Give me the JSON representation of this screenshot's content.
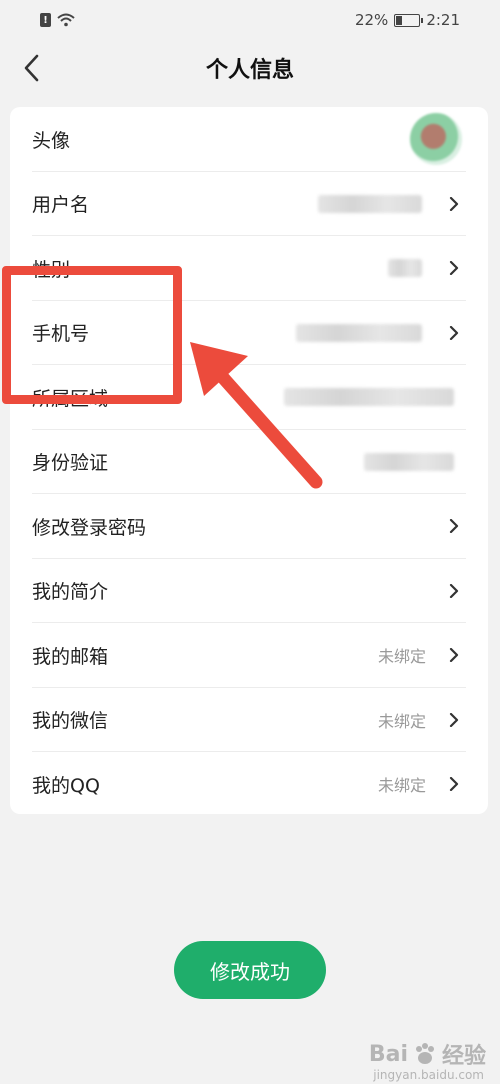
{
  "status_bar": {
    "sim_label": "!",
    "battery_percent": "22%",
    "time": "2:21"
  },
  "header": {
    "title": "个人信息"
  },
  "rows": [
    {
      "label": "头像",
      "value": ""
    },
    {
      "label": "用户名",
      "value": ""
    },
    {
      "label": "性别",
      "value": ""
    },
    {
      "label": "手机号",
      "value": ""
    },
    {
      "label": "所属区域",
      "value": ""
    },
    {
      "label": "身份验证",
      "value": ""
    },
    {
      "label": "修改登录密码",
      "value": ""
    },
    {
      "label": "我的简介",
      "value": ""
    },
    {
      "label": "我的邮箱",
      "value": "未绑定"
    },
    {
      "label": "我的微信",
      "value": "未绑定"
    },
    {
      "label": "我的QQ",
      "value": "未绑定"
    }
  ],
  "footer": {
    "button_label": "修改成功"
  },
  "watermark": {
    "brand": "Bai",
    "suffix": "经验",
    "site": "jingyan.baidu.com"
  },
  "colors": {
    "accent": "#1fae6b",
    "highlight": "#ec4b3c",
    "background": "#f2f2f2"
  }
}
